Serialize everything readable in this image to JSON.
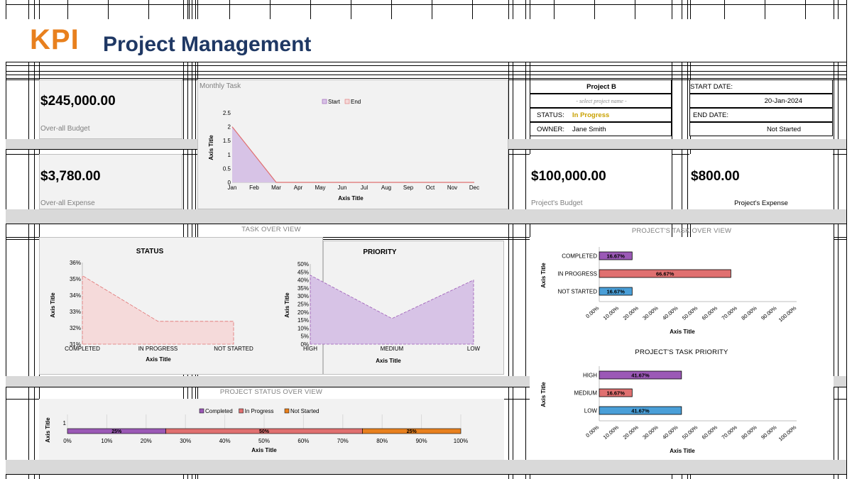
{
  "header": {
    "kpi_word": "KPI",
    "title": "Project Management",
    "kpi_color": "#e8801e",
    "title_color": "#1f3864"
  },
  "cards": {
    "overall_budget_value": "$245,000.00",
    "overall_budget_label": "Over-all Budget",
    "overall_expense_value": "$3,780.00",
    "overall_expense_label": "Over-all Expense",
    "project_budget_value": "$100,000.00",
    "project_budget_label": "Project's Budget",
    "project_expense_value": "$800.00",
    "project_expense_label": "Project's Expense"
  },
  "project": {
    "name": "Project B",
    "select_hint": "- select project name -",
    "status_label": "STATUS:",
    "status_value": "In Progress",
    "status_color": "#c9a100",
    "owner_label": "OWNER:",
    "owner_value": "Jane Smith",
    "start_label": "START DATE:",
    "start_value": "20-Jan-2024",
    "end_label": "END DATE:",
    "end_value": "Not Started"
  },
  "sections": {
    "monthly_task": "Monthly Task",
    "task_overview": "TASK OVER VIEW",
    "projects_task_overview": "PROJECT'S TASK OVER VIEW",
    "projects_task_priority": "PROJECT'S TASK PRIORITY",
    "project_status_overview": "PROJECT STATUS OVER VIEW"
  },
  "colors": {
    "purple": "#9b59b6",
    "purple_fill": "#d7c3e6",
    "pink": "#e07070",
    "pink_fill": "#f5dada",
    "blue": "#4a9fd8",
    "orange": "#e8801e"
  },
  "chart_data": [
    {
      "id": "monthly",
      "type": "area",
      "categories": [
        "Jan",
        "Feb",
        "Mar",
        "Apr",
        "May",
        "Jun",
        "Jul",
        "Aug",
        "Sep",
        "Oct",
        "Nov",
        "Dec"
      ],
      "series": [
        {
          "name": "Start",
          "values": [
            2,
            1,
            0,
            0,
            0,
            0,
            0,
            0,
            0,
            0,
            0,
            0
          ]
        },
        {
          "name": "End",
          "values": [
            2,
            1,
            0,
            0,
            0,
            0,
            0,
            0,
            0,
            0,
            0,
            0
          ]
        }
      ],
      "ylim": [
        0,
        2.5
      ],
      "yticks": [
        "0",
        "0.5",
        "1",
        "1.5",
        "2",
        "2.5"
      ],
      "xlabel": "Axis Title",
      "ylabel": "Axis Title",
      "legend": "top"
    },
    {
      "id": "status",
      "type": "area",
      "title": "STATUS",
      "categories": [
        "COMPLETED",
        "IN PROGRESS",
        "NOT STARTED"
      ],
      "values": [
        35.2,
        32.4,
        32.4
      ],
      "ylim": [
        31,
        36
      ],
      "yticks": [
        "31%",
        "32%",
        "33%",
        "34%",
        "35%",
        "36%"
      ],
      "xlabel": "Axis Title",
      "ylabel": "Axis Title"
    },
    {
      "id": "priority",
      "type": "area",
      "title": "PRIORITY",
      "categories": [
        "HIGH",
        "MEDIUM",
        "LOW"
      ],
      "values": [
        43,
        16,
        40
      ],
      "ylim": [
        0,
        50
      ],
      "yticks": [
        "0%",
        "5%",
        "10%",
        "15%",
        "20%",
        "25%",
        "30%",
        "35%",
        "40%",
        "45%",
        "50%"
      ],
      "xlabel": "Axis Title",
      "ylabel": "Axis Title"
    },
    {
      "id": "project_task",
      "type": "bar",
      "categories": [
        "COMPLETED",
        "IN PROGRESS",
        "NOT STARTED"
      ],
      "values": [
        16.67,
        66.67,
        16.67
      ],
      "labels": [
        "16.67%",
        "66.67%",
        "16.67%"
      ],
      "xlim": [
        0,
        100
      ],
      "xticks": [
        "0.00%",
        "10.00%",
        "20.00%",
        "30.00%",
        "40.00%",
        "50.00%",
        "60.00%",
        "70.00%",
        "80.00%",
        "90.00%",
        "100.00%"
      ],
      "xlabel": "Axis Title",
      "ylabel": "Axis Title"
    },
    {
      "id": "project_priority",
      "type": "bar",
      "categories": [
        "HIGH",
        "MEDIUM",
        "LOW"
      ],
      "values": [
        41.67,
        16.67,
        41.67
      ],
      "labels": [
        "41.67%",
        "16.67%",
        "41.67%"
      ],
      "xlim": [
        0,
        100
      ],
      "xticks": [
        "0.00%",
        "10.00%",
        "20.00%",
        "30.00%",
        "40.00%",
        "50.00%",
        "60.00%",
        "70.00%",
        "80.00%",
        "90.00%",
        "100.00%"
      ],
      "xlabel": "Axis Title",
      "ylabel": "Axis Title"
    },
    {
      "id": "status_overview",
      "type": "bar",
      "series": [
        {
          "name": "Completed",
          "value": 25,
          "label": "25%"
        },
        {
          "name": "In Progress",
          "value": 50,
          "label": "50%"
        },
        {
          "name": "Not Started",
          "value": 25,
          "label": "25%"
        }
      ],
      "y_tick": "1",
      "xlim": [
        0,
        100
      ],
      "xticks": [
        "0%",
        "10%",
        "20%",
        "30%",
        "40%",
        "50%",
        "60%",
        "70%",
        "80%",
        "90%",
        "100%"
      ],
      "xlabel": "Axis Title",
      "ylabel": "Axis Title",
      "legend": "top"
    }
  ]
}
